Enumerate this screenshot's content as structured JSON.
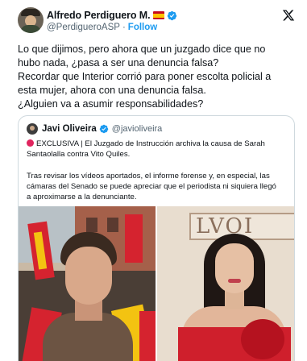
{
  "author": {
    "display_name": "Alfredo Perdiguero M.",
    "handle": "@PerdigueroASP",
    "separator": "·",
    "follow_label": "Follow"
  },
  "icons": {
    "flag": "spain-flag-emoji",
    "verified": "verified-badge-icon",
    "logo": "x-logo-icon"
  },
  "colors": {
    "accent": "#1d9bf0",
    "muted": "#536471",
    "text": "#0f1419",
    "border": "#cfd9de",
    "red_dot": "#e0245e"
  },
  "tweet": {
    "lines": [
      "Lo que dijimos, pero ahora que un juzgado dice que no",
      "hubo nada, ¿pasa a ser una denuncia falsa?",
      "Recordar que Interior corrió para poner escolta policial a",
      "esta mujer, ahora con una denuncia falsa.",
      "¿Alguien va a asumir responsabilidades?"
    ]
  },
  "quote": {
    "display_name": "Javi Oliveira",
    "handle": "@javioliveira",
    "lines": [
      "EXCLUSIVA | El Juzgado de Instrucción archiva la causa de Sarah",
      "Santaolalla contra Vito Quiles."
    ],
    "lines2": [
      "Tras revisar los vídeos aportados, el informe forense y, en especial, las",
      "cámaras del Senado se puede apreciar que el periodista ni siquiera llegó",
      "a aproximarse a la denunciante."
    ],
    "photo_sign_text": "LVOI"
  }
}
